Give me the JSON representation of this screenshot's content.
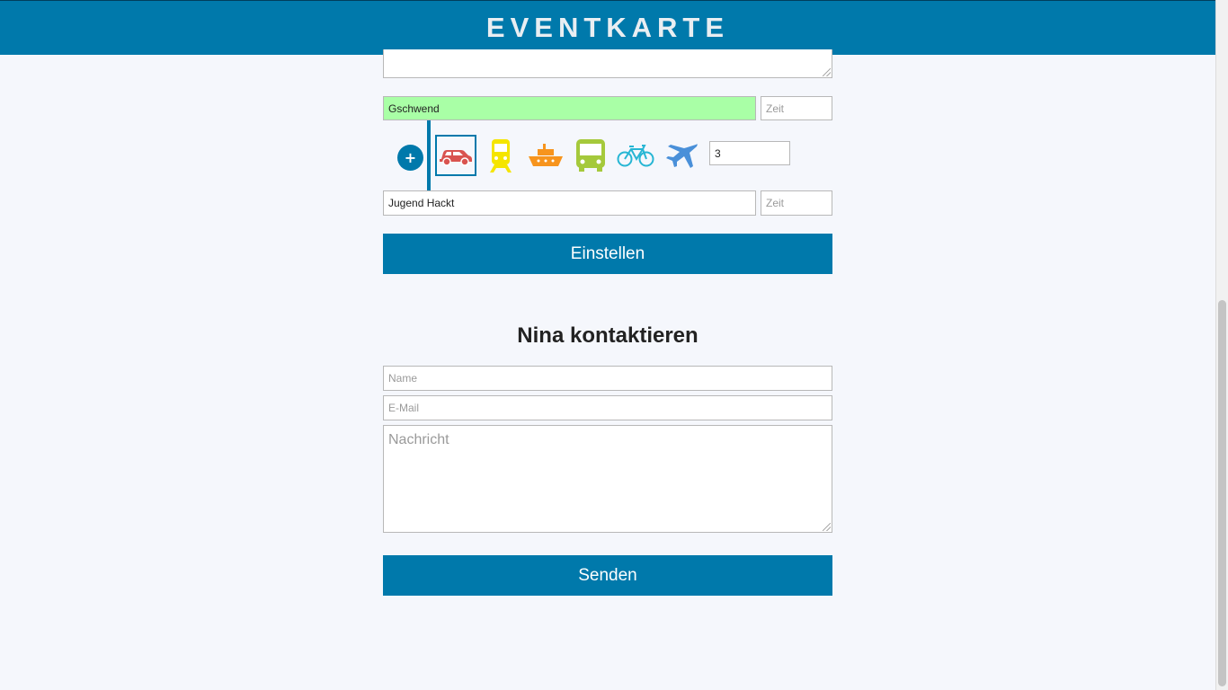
{
  "header": {
    "title": "EVENTKARTE"
  },
  "route": {
    "from": {
      "value": "Gschwend",
      "time_placeholder": "Zeit"
    },
    "to": {
      "value": "Jugend Hackt",
      "time_placeholder": "Zeit"
    },
    "add_label": "+",
    "transport_modes": [
      {
        "name": "car",
        "icon": "car-icon",
        "color": "#d9534f",
        "selected": true
      },
      {
        "name": "train",
        "icon": "train-icon",
        "color": "#f5e500",
        "selected": false
      },
      {
        "name": "ship",
        "icon": "ship-icon",
        "color": "#f7941d",
        "selected": false
      },
      {
        "name": "bus",
        "icon": "bus-icon",
        "color": "#a5c93b",
        "selected": false
      },
      {
        "name": "bike",
        "icon": "bike-icon",
        "color": "#27b6d4",
        "selected": false
      },
      {
        "name": "plane",
        "icon": "plane-icon",
        "color": "#4a90d9",
        "selected": false
      }
    ],
    "count_value": "3",
    "submit_label": "Einstellen"
  },
  "contact": {
    "heading": "Nina kontaktieren",
    "name_placeholder": "Name",
    "email_placeholder": "E-Mail",
    "message_placeholder": "Nachricht",
    "submit_label": "Senden"
  },
  "colors": {
    "accent": "#0079ab",
    "highlight_field": "#a9ffa6",
    "background": "#f5f7fc"
  }
}
